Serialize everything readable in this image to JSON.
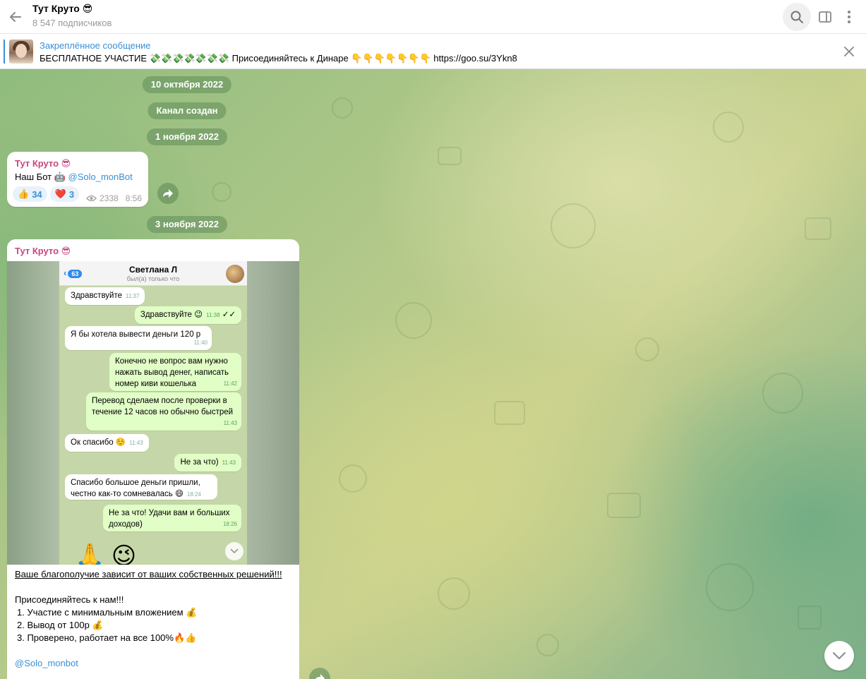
{
  "header": {
    "title": "Тут Круто 😎",
    "subscribers": "8 547 подписчиков"
  },
  "pinned": {
    "label": "Закреплённое сообщение",
    "text": "БЕСПЛАТНОЕ УЧАСТИЕ 💸💸💸💸💸💸💸 Присоединяйтесь к  Динаре  👇👇👇👇👇👇👇 https://goo.su/3Ykn8"
  },
  "service": {
    "date1": "10 октября 2022",
    "created": "Канал создан",
    "date2": "1 ноября 2022",
    "date3": "3 ноября 2022"
  },
  "msg1": {
    "author": "Тут Круто 😎",
    "text_prefix": "Наш Бот 🤖 ",
    "link": "@Solo_monBot",
    "reactions": [
      {
        "emoji": "👍",
        "count": "34"
      },
      {
        "emoji": "❤️",
        "count": "3"
      }
    ],
    "views": "2338",
    "time": "8:56"
  },
  "msg2": {
    "author": "Тут Круто 😎",
    "screenshot": {
      "back_count": "63",
      "name": "Светлана Л",
      "status": "был(а) только что",
      "messages": [
        {
          "dir": "in",
          "text": "Здравствуйте",
          "time": "11:37"
        },
        {
          "dir": "out",
          "text": "Здравствуйте 😉",
          "time": "11:38"
        },
        {
          "dir": "in",
          "text": "Я бы хотела вывести деньги 120 р",
          "time": "11:40"
        },
        {
          "dir": "out",
          "text": "Конечно не вопрос вам нужно нажать вывод денег, написать номер киви кошелька",
          "time": "11:42"
        },
        {
          "dir": "out",
          "text": "Перевод сделаем после проверки в течение 12 часов но обычно быстрей",
          "time": "11:43"
        },
        {
          "dir": "in",
          "text": "Ок спасибо ☺️",
          "time": "11:43"
        },
        {
          "dir": "out",
          "text": "Не за что)",
          "time": "11:43"
        },
        {
          "dir": "in",
          "text": "Спасибо большое деньги пришли, честно как-то сомневалась 😄",
          "time": "18:24"
        },
        {
          "dir": "out",
          "text": "Не за что! Удачи вам и больших доходов)",
          "time": "18:26"
        }
      ],
      "big_emoji": "🙏 😉"
    },
    "caption": {
      "headline": "Ваше благополучие зависит от ваших собственных решений!!!",
      "join": "Присоединяйтесь к нам!!!",
      "items": [
        "1. Участие с минимальным вложением 💰",
        "2. Вывод от 100р  💰",
        "3. Проверено, работает на все 100%🔥👍"
      ],
      "link": "@Solo_monbot"
    }
  },
  "icons": {
    "back": "arrow-left-icon",
    "search": "search-icon",
    "sidebar": "sidebar-toggle-icon",
    "more": "more-vertical-icon",
    "close": "close-icon",
    "forward": "forward-icon",
    "views": "eye-icon",
    "scroll": "chevron-down-icon"
  },
  "colors": {
    "accent": "#3a8fd6",
    "author": "#c8467e",
    "service_bg": "#608c5a"
  }
}
